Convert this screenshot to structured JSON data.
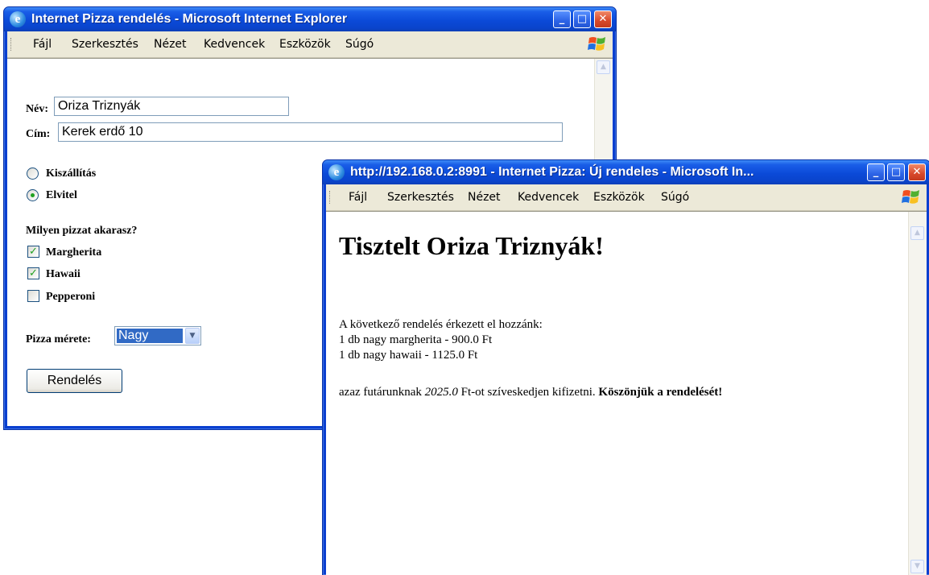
{
  "window1": {
    "title": "Internet Pizza rendelés - Microsoft Internet Explorer",
    "menu": [
      "Fájl",
      "Szerkesztés",
      "Nézet",
      "Kedvencek",
      "Eszközök",
      "Súgó"
    ],
    "form": {
      "name_label": "Név:",
      "name_value": "Oriza Triznyák",
      "address_label": "Cím:",
      "address_value": "Kerek erdő 10",
      "delivery_options": [
        {
          "label": "Kiszállítás",
          "selected": false
        },
        {
          "label": "Elvitel",
          "selected": true
        }
      ],
      "question": "Milyen pizzat akarasz?",
      "pizzas": [
        {
          "label": "Margherita",
          "checked": true
        },
        {
          "label": "Hawaii",
          "checked": true
        },
        {
          "label": "Pepperoni",
          "checked": false
        }
      ],
      "size_label": "Pizza mérete:",
      "size_value": "Nagy",
      "submit_label": "Rendelés"
    }
  },
  "window2": {
    "title": "http://192.168.0.2:8991 - Internet Pizza: Új rendeles - Microsoft In...",
    "menu": [
      "Fájl",
      "Szerkesztés",
      "Nézet",
      "Kedvencek",
      "Eszközök",
      "Súgó"
    ],
    "heading": "Tisztelt Oriza Triznyák!",
    "intro": "A következő rendelés érkezett el hozzánk:",
    "lines": [
      "1 db nagy margherita - 900.0 Ft",
      "1 db nagy hawaii - 1125.0 Ft"
    ],
    "total_prefix": "azaz futárunknak ",
    "total_amount": "2025.0",
    "total_suffix": " Ft-ot szíveskedjen kifizetni. ",
    "thanks": "Köszönjük a rendelését!"
  },
  "titlebar_buttons": {
    "minimize": "_",
    "maximize": "□",
    "close": "✕"
  },
  "colors": {
    "titlebar": "#0a44cc",
    "close_button": "#d8482a",
    "menubar": "#ece9d8"
  }
}
